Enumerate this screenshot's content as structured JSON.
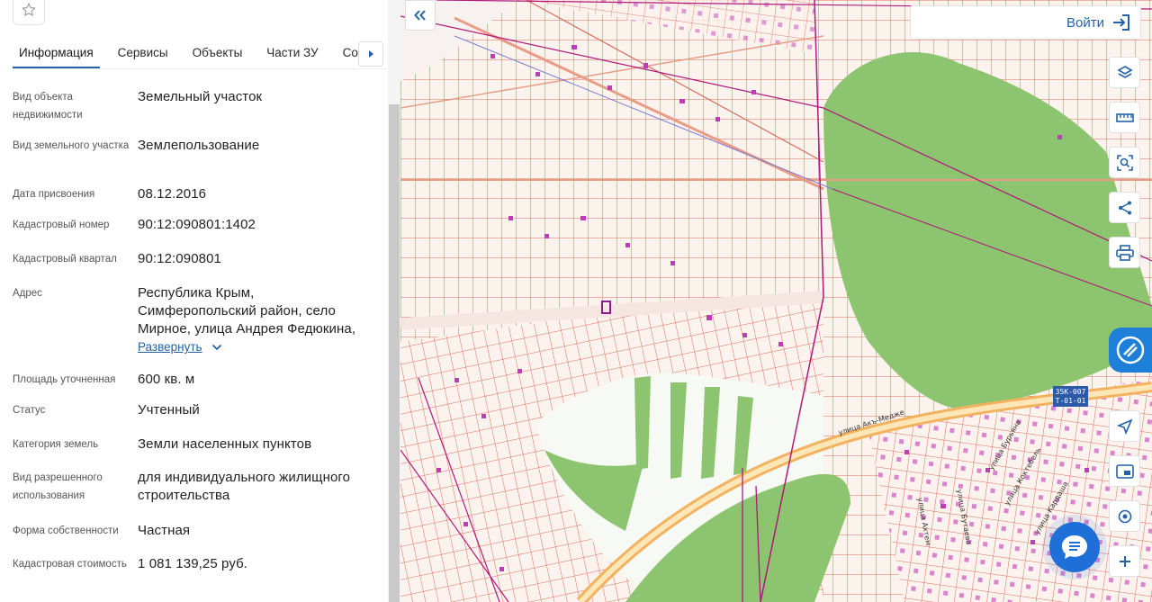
{
  "tabs": [
    "Информация",
    "Сервисы",
    "Объекты",
    "Части ЗУ",
    "Состав ЕЗП"
  ],
  "active_tab": "Информация",
  "fields": [
    {
      "label": "Вид объекта недвижимости",
      "value": "Земельный участок"
    },
    {
      "label": "Вид земельного участка",
      "value": "Землепользование"
    },
    {
      "label": "Дата присвоения",
      "value": "08.12.2016"
    },
    {
      "label": "Кадастровый номер",
      "value": "90:12:090801:1402"
    },
    {
      "label": "Кадастровый квартал",
      "value": "90:12:090801"
    },
    {
      "label": "Адрес",
      "value": "Республика Крым, Симферопольский район, село Мирное, улица Андрея Федюкина,"
    },
    {
      "label": "Площадь уточненная",
      "value": "600 кв. м"
    },
    {
      "label": "Статус",
      "value": "Учтенный"
    },
    {
      "label": "Категория земель",
      "value": "Земли населенных пунктов"
    },
    {
      "label": "Вид разрешенного использования",
      "value": "для индивидуального жилищного строительства"
    },
    {
      "label": "Форма собственности",
      "value": "Частная"
    },
    {
      "label": "Кадастровая стоимость",
      "value": "1 081 139,25 руб."
    }
  ],
  "expand_label": "Развернуть",
  "login_label": "Войти",
  "road_sign": [
    "35К-007",
    "Т-01-01"
  ],
  "streets": [
    "улица Акъ-Медже",
    "улица Бурьяна",
    "улица Коктебель",
    "улица Кардаша",
    "улица Ахтем",
    "улица Бутаева"
  ],
  "map_tools": [
    "layers-icon",
    "ruler-icon",
    "area-select-icon",
    "share-icon",
    "print-icon",
    "navigate-icon",
    "minimap-icon",
    "locate-icon",
    "zoom-in-icon"
  ],
  "colors": {
    "accent": "#2462a8",
    "parcel_line": "#d96b5a",
    "cadastral_line": "#b0187a",
    "green": "#8dc46f",
    "road": "#f3b25f",
    "building": "#c23bb6"
  }
}
